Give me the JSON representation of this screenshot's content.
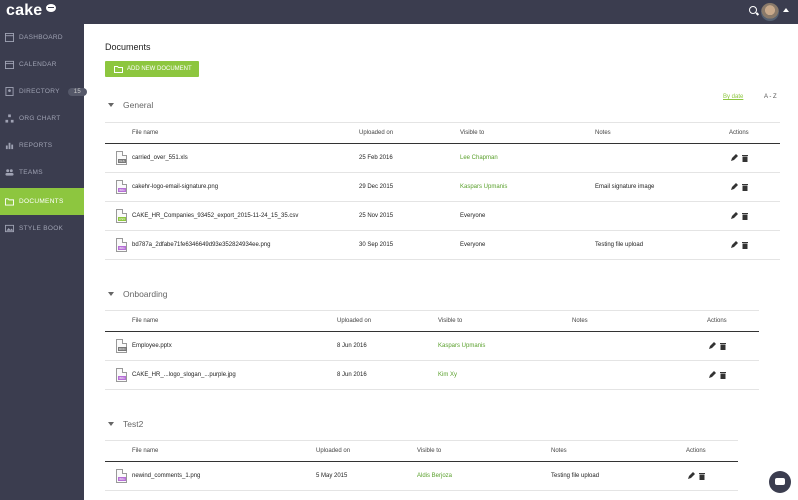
{
  "app": {
    "logo": "cake"
  },
  "colors": {
    "sidebar": "#3b3d4f",
    "accent": "#8dc63f",
    "link_green": "#5aa02c"
  },
  "sidebar": {
    "items": [
      {
        "label": "DASHBOARD",
        "icon": "dashboard-icon"
      },
      {
        "label": "CALENDAR",
        "icon": "calendar-icon"
      },
      {
        "label": "DIRECTORY",
        "icon": "directory-icon",
        "badge": "15"
      },
      {
        "label": "ORG CHART",
        "icon": "org-chart-icon"
      },
      {
        "label": "REPORTS",
        "icon": "reports-icon"
      },
      {
        "label": "TEAMS",
        "icon": "teams-icon"
      },
      {
        "label": "DOCUMENTS",
        "icon": "folder-icon",
        "active": true
      },
      {
        "label": "STYLE BOOK",
        "icon": "style-book-icon"
      }
    ]
  },
  "page": {
    "title": "Documents",
    "add_button": "ADD NEW DOCUMENT",
    "sort_by_date": "By date",
    "sort_az": "A - Z"
  },
  "columns": {
    "file": "File name",
    "uploaded": "Uploaded on",
    "visible": "Visible to",
    "notes": "Notes",
    "actions": "Actions"
  },
  "sections": [
    {
      "name": "General",
      "rows": [
        {
          "file": "carried_over_551.xls",
          "type": "xls",
          "date": "25 Feb 2016",
          "visible": "Lee Chapman",
          "visible_green": true,
          "notes": ""
        },
        {
          "file": "cakehr-logo-email-signature.png",
          "type": "img",
          "date": "29 Dec 2015",
          "visible": "Kaspars Upmanis",
          "visible_green": true,
          "notes": "Email signature image"
        },
        {
          "file": "CAKE_HR_Companies_93452_export_2015-11-24_15_35.csv",
          "type": "csv",
          "date": "25 Nov 2015",
          "visible": "Everyone",
          "visible_green": false,
          "notes": ""
        },
        {
          "file": "bd787a_2dfabe71fe6346649d93e352824934ee.png",
          "type": "img",
          "date": "30 Sep 2015",
          "visible": "Everyone",
          "visible_green": false,
          "notes": "Testing file upload"
        }
      ]
    },
    {
      "name": "Onboarding",
      "rows": [
        {
          "file": "Employee.pptx",
          "type": "doc",
          "date": "8 Jun 2016",
          "visible": "Kaspars Upmanis",
          "visible_green": true,
          "notes": ""
        },
        {
          "file": "CAKE_HR_...logo_slogan_...purple.jpg",
          "type": "img",
          "date": "8 Jun 2016",
          "visible": "Kim Xy",
          "visible_green": true,
          "notes": ""
        }
      ]
    },
    {
      "name": "Test2",
      "rows": [
        {
          "file": "newind_comments_1.png",
          "type": "img",
          "date": "5 May 2015",
          "visible": "Aldis Berjoza",
          "visible_green": true,
          "notes": "Testing file upload"
        }
      ]
    }
  ]
}
